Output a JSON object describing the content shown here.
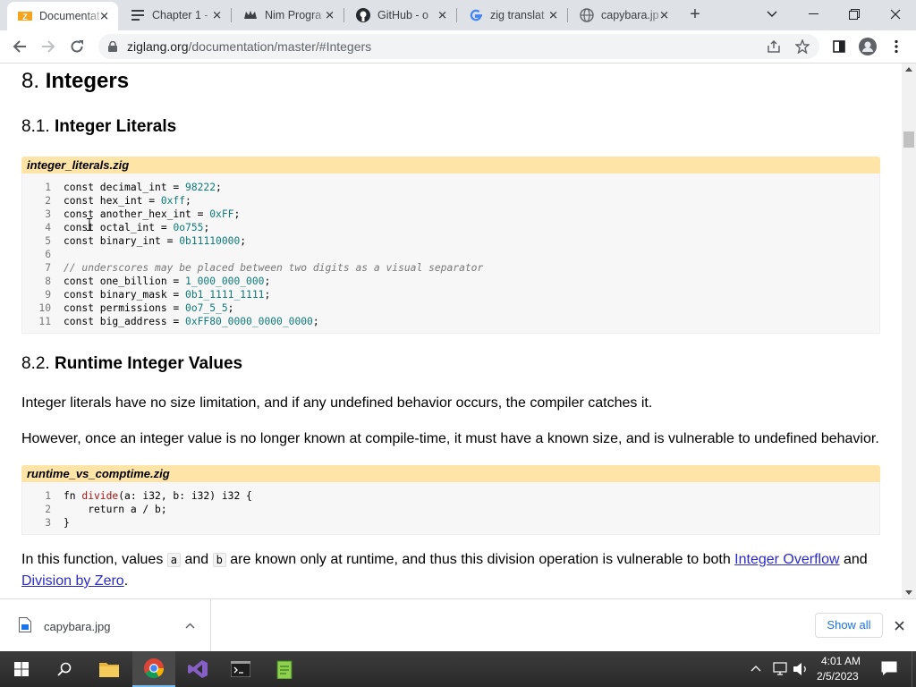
{
  "browser": {
    "tabs": [
      {
        "title": "Documentat",
        "icon": "zig-icon",
        "active": true
      },
      {
        "title": "Chapter 1 -",
        "icon": "list-icon",
        "active": false
      },
      {
        "title": "Nim Progra",
        "icon": "nim-icon",
        "active": false
      },
      {
        "title": "GitHub - o",
        "icon": "github-icon",
        "active": false
      },
      {
        "title": "zig translat",
        "icon": "google-icon",
        "active": false
      },
      {
        "title": "capybara.jp",
        "icon": "globe-icon",
        "active": false
      }
    ],
    "url_host": "ziglang.org",
    "url_path": "/documentation/master/#Integers"
  },
  "doc": {
    "h_integers_num": "8.",
    "h_integers": "Integers",
    "h_literals_num": "8.1.",
    "h_literals": "Integer Literals",
    "file1": "integer_literals.zig",
    "code1": [
      {
        "n": "1",
        "parts": [
          [
            "",
            "const decimal_int = "
          ],
          [
            "num",
            "98222"
          ],
          [
            "",
            ";"
          ]
        ]
      },
      {
        "n": "2",
        "parts": [
          [
            "",
            "const hex_int = "
          ],
          [
            "num",
            "0xff"
          ],
          [
            "",
            ";"
          ]
        ]
      },
      {
        "n": "3",
        "parts": [
          [
            "",
            "const another_hex_int = "
          ],
          [
            "num",
            "0xFF"
          ],
          [
            "",
            ";"
          ]
        ]
      },
      {
        "n": "4",
        "parts": [
          [
            "",
            "const octal_int = "
          ],
          [
            "num",
            "0o755"
          ],
          [
            "",
            ";"
          ]
        ]
      },
      {
        "n": "5",
        "parts": [
          [
            "",
            "const binary_int = "
          ],
          [
            "num",
            "0b11110000"
          ],
          [
            "",
            ";"
          ]
        ]
      },
      {
        "n": "6",
        "parts": []
      },
      {
        "n": "7",
        "parts": [
          [
            "cmt",
            "// underscores may be placed between two digits as a visual separator"
          ]
        ]
      },
      {
        "n": "8",
        "parts": [
          [
            "",
            "const one_billion = "
          ],
          [
            "num",
            "1_000_000_000"
          ],
          [
            "",
            ";"
          ]
        ]
      },
      {
        "n": "9",
        "parts": [
          [
            "",
            "const binary_mask = "
          ],
          [
            "num",
            "0b1_1111_1111"
          ],
          [
            "",
            ";"
          ]
        ]
      },
      {
        "n": "10",
        "parts": [
          [
            "",
            "const permissions = "
          ],
          [
            "num",
            "0o7_5_5"
          ],
          [
            "",
            ";"
          ]
        ]
      },
      {
        "n": "11",
        "parts": [
          [
            "",
            "const big_address = "
          ],
          [
            "num",
            "0xFF80_0000_0000_0000"
          ],
          [
            "",
            ";"
          ]
        ]
      }
    ],
    "h_runtime_num": "8.2.",
    "h_runtime": "Runtime Integer Values",
    "para1": "Integer literals have no size limitation, and if any undefined behavior occurs, the compiler catches it.",
    "para2": "However, once an integer value is no longer known at compile-time, it must have a known size, and is vulnerable to undefined behavior.",
    "file2": "runtime_vs_comptime.zig",
    "code2": [
      {
        "n": "1",
        "parts": [
          [
            "",
            "fn "
          ],
          [
            "fn",
            "divide"
          ],
          [
            "",
            "(a: i32, b: i32) i32 {"
          ]
        ]
      },
      {
        "n": "2",
        "parts": [
          [
            "",
            "    return a / b;"
          ]
        ]
      },
      {
        "n": "3",
        "parts": [
          [
            "",
            "}"
          ]
        ]
      }
    ],
    "para3_a": "In this function, values ",
    "para3_code_a": "a",
    "para3_b": " and ",
    "para3_code_b": "b",
    "para3_c": " are known only at runtime, and thus this division operation is vulnerable to both ",
    "link_overflow": "Integer Overflow",
    "para3_d": " and",
    "link_div_zero": "Division by Zero",
    "para3_e": "."
  },
  "downloads": {
    "file_name": "capybara.jpg",
    "show_all": "Show all"
  },
  "taskbar": {
    "time": "4:01 AM",
    "date": "2/5/2023"
  }
}
